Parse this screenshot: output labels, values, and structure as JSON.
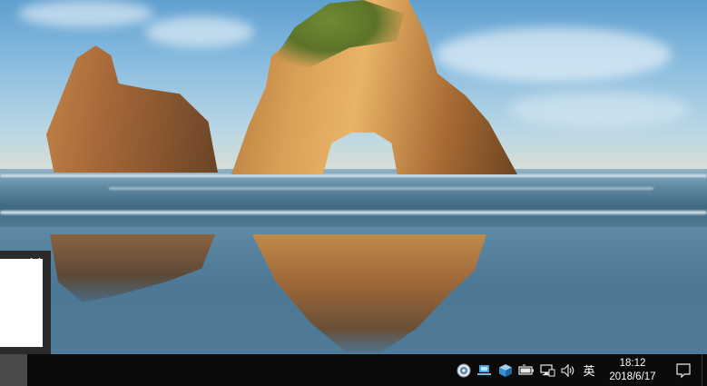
{
  "popup": {
    "close_glyph": "✕"
  },
  "taskbar": {
    "tray": {
      "icons": [
        "circle-app-icon",
        "network-share-icon",
        "cube-app-icon",
        "battery-icon",
        "network-icon",
        "volume-icon"
      ],
      "ime_label": "英",
      "clock_time": "18:12",
      "clock_date": "2018/6/17"
    },
    "notification_icon": "action-center-icon"
  },
  "colors": {
    "taskbar": "#0b0b0b",
    "popup_frame": "#2b2b2b"
  }
}
